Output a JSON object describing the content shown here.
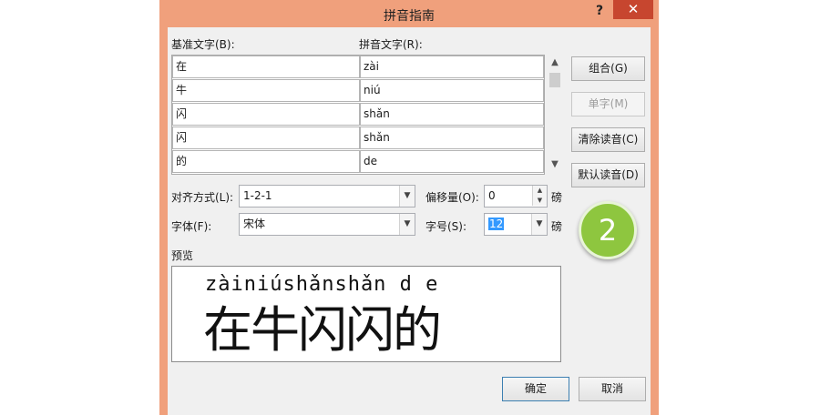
{
  "window": {
    "title": "拼音指南",
    "help_label": "?",
    "close_label": "✕"
  },
  "grid": {
    "base_header": "基准文字(B):",
    "pinyin_header": "拼音文字(R):",
    "rows": [
      {
        "base": "在",
        "pinyin": "zài"
      },
      {
        "base": "牛",
        "pinyin": "niú"
      },
      {
        "base": "闪",
        "pinyin": "shǎn"
      },
      {
        "base": "闪",
        "pinyin": "shǎn"
      },
      {
        "base": "的",
        "pinyin": "de"
      }
    ],
    "scroll_up": "▲",
    "scroll_down": "▼"
  },
  "buttons": {
    "group": "组合(G)",
    "single": "单字(M)",
    "clear": "清除读音(C)",
    "default": "默认读音(D)",
    "ok": "确定",
    "cancel": "取消"
  },
  "options": {
    "alignment_label": "对齐方式(L):",
    "alignment_value": "1-2-1",
    "offset_label": "偏移量(O):",
    "offset_value": "0",
    "offset_unit": "磅",
    "font_label": "字体(F):",
    "font_value": "宋体",
    "size_label": "字号(S):",
    "size_value": "12",
    "size_unit": "磅"
  },
  "preview": {
    "label": "预览",
    "pinyin": "zàiniúshǎnshǎn d e",
    "text": "在牛闪闪的"
  },
  "badge": {
    "number": "2",
    "color": "#8ec63f"
  },
  "colors": {
    "window_frame": "#f0a07c",
    "close_button": "#c7462f",
    "dialog_bg": "#f0f0f0",
    "selection": "#3399ff"
  }
}
